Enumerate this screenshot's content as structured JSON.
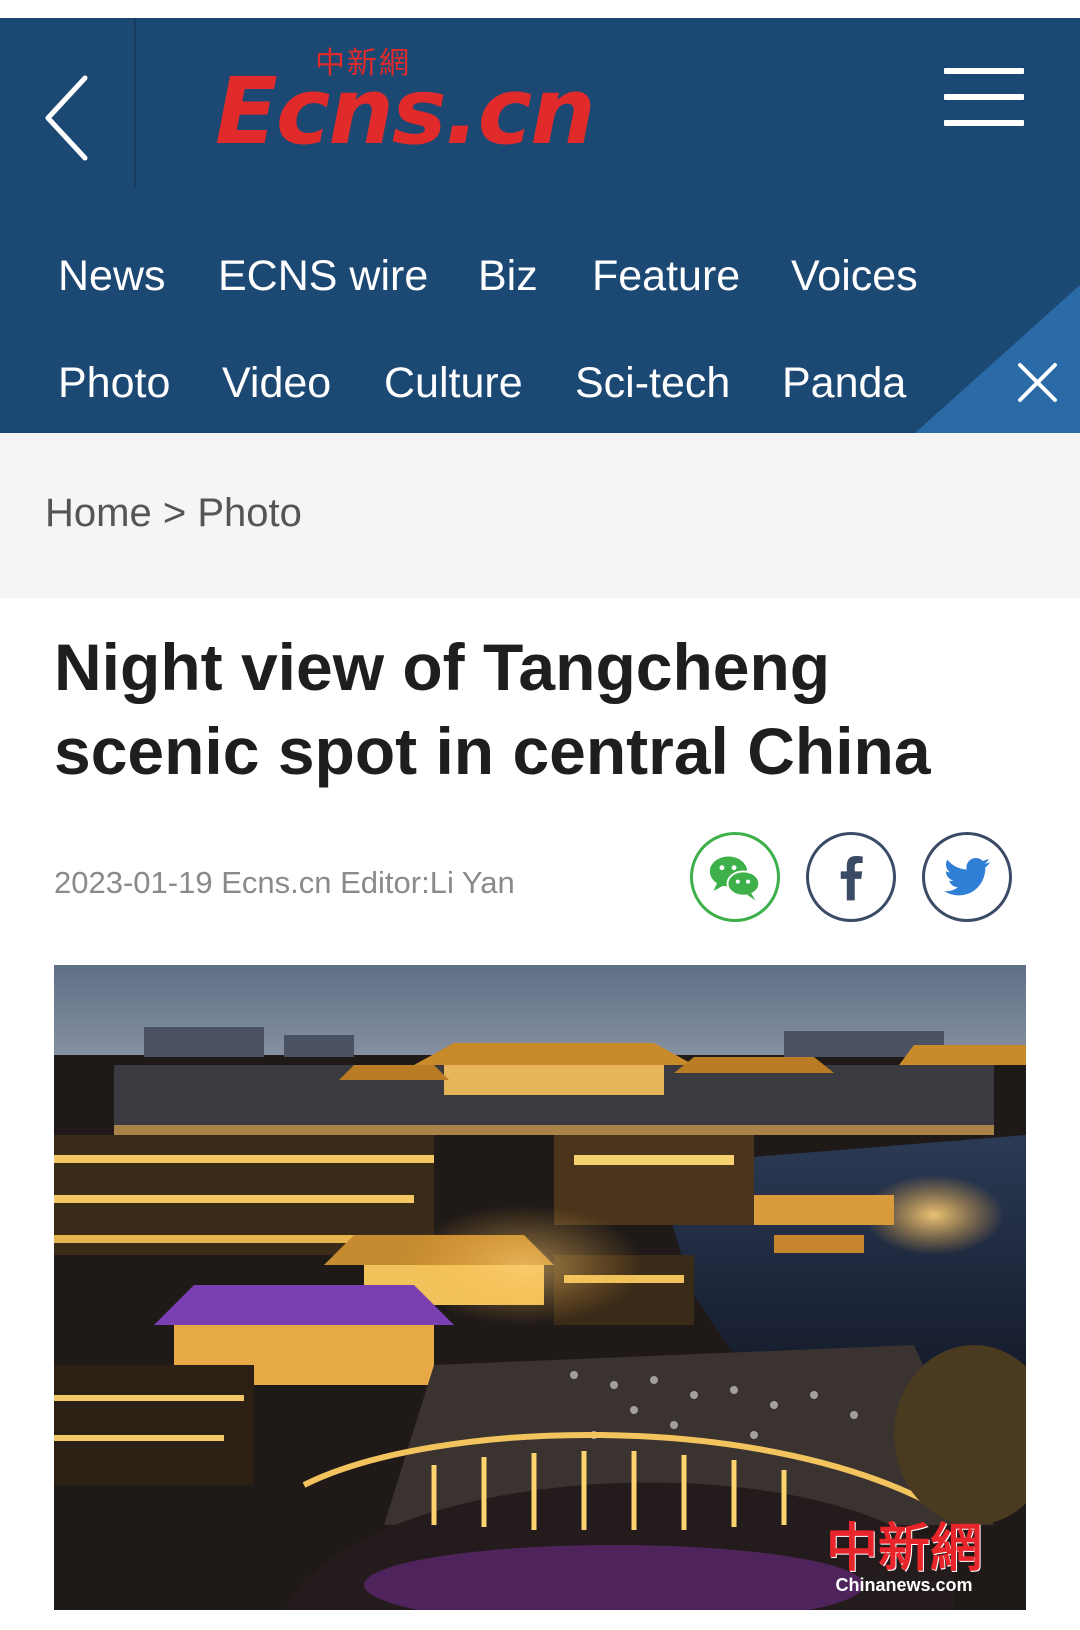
{
  "header": {
    "logo_cn": "中新網",
    "logo_text": "Ecns.cn",
    "colors": {
      "header_bg": "#1c4874",
      "logo_red": "#e12a2a"
    }
  },
  "nav": {
    "row1": [
      "News",
      "ECNS wire",
      "Biz",
      "Feature",
      "Voices"
    ],
    "row2": [
      "Photo",
      "Video",
      "Culture",
      "Sci-tech",
      "Panda"
    ]
  },
  "breadcrumb": {
    "home": "Home",
    "separator": ">",
    "current": "Photo"
  },
  "article": {
    "title": "Night view of Tangcheng scenic spot in central China",
    "date": "2023-01-19",
    "source": "Ecns.cn",
    "editor": "Editor:Li Yan"
  },
  "share": [
    "wechat-icon",
    "facebook-icon",
    "twitter-icon"
  ],
  "photo": {
    "watermark_cn": "中新網",
    "watermark_en": "Chinanews.com"
  }
}
